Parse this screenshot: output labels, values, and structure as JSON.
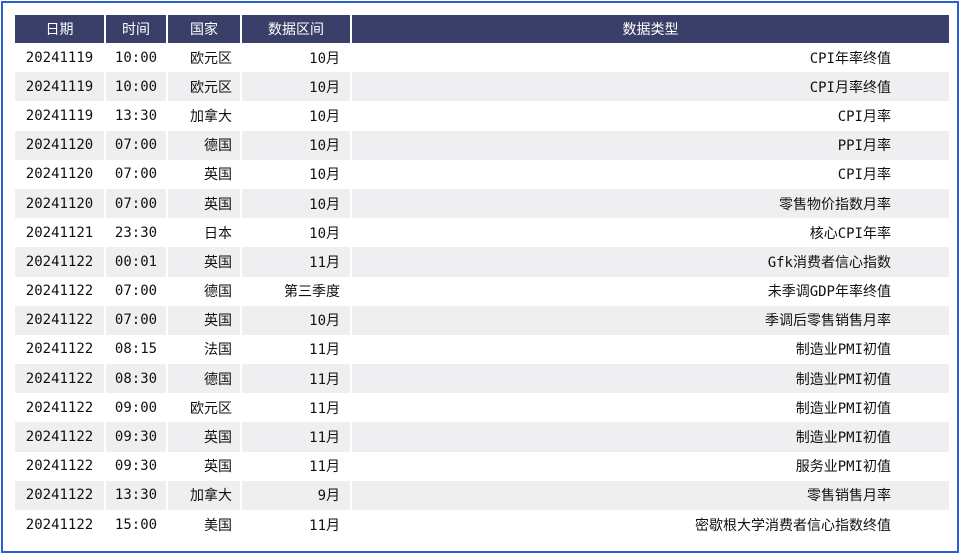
{
  "table": {
    "headers": [
      "日期",
      "时间",
      "国家",
      "数据区间",
      "数据类型"
    ],
    "rows": [
      [
        "20241119",
        "10:00",
        "欧元区",
        "10月",
        "CPI年率终值"
      ],
      [
        "20241119",
        "10:00",
        "欧元区",
        "10月",
        "CPI月率终值"
      ],
      [
        "20241119",
        "13:30",
        "加拿大",
        "10月",
        "CPI月率"
      ],
      [
        "20241120",
        "07:00",
        "德国",
        "10月",
        "PPI月率"
      ],
      [
        "20241120",
        "07:00",
        "英国",
        "10月",
        "CPI月率"
      ],
      [
        "20241120",
        "07:00",
        "英国",
        "10月",
        "零售物价指数月率"
      ],
      [
        "20241121",
        "23:30",
        "日本",
        "10月",
        "核心CPI年率"
      ],
      [
        "20241122",
        "00:01",
        "英国",
        "11月",
        "Gfk消费者信心指数"
      ],
      [
        "20241122",
        "07:00",
        "德国",
        "第三季度",
        "未季调GDP年率终值"
      ],
      [
        "20241122",
        "07:00",
        "英国",
        "10月",
        "季调后零售销售月率"
      ],
      [
        "20241122",
        "08:15",
        "法国",
        "11月",
        "制造业PMI初值"
      ],
      [
        "20241122",
        "08:30",
        "德国",
        "11月",
        "制造业PMI初值"
      ],
      [
        "20241122",
        "09:00",
        "欧元区",
        "11月",
        "制造业PMI初值"
      ],
      [
        "20241122",
        "09:30",
        "英国",
        "11月",
        "制造业PMI初值"
      ],
      [
        "20241122",
        "09:30",
        "英国",
        "11月",
        "服务业PMI初值"
      ],
      [
        "20241122",
        "13:30",
        "加拿大",
        "9月",
        "零售销售月率"
      ],
      [
        "20241122",
        "15:00",
        "美国",
        "11月",
        "密歇根大学消费者信心指数终值"
      ]
    ]
  },
  "colors": {
    "header_bg": "#3a3f6a",
    "stripe_bg": "#efeff1",
    "frame_border": "#2a5fd6"
  }
}
